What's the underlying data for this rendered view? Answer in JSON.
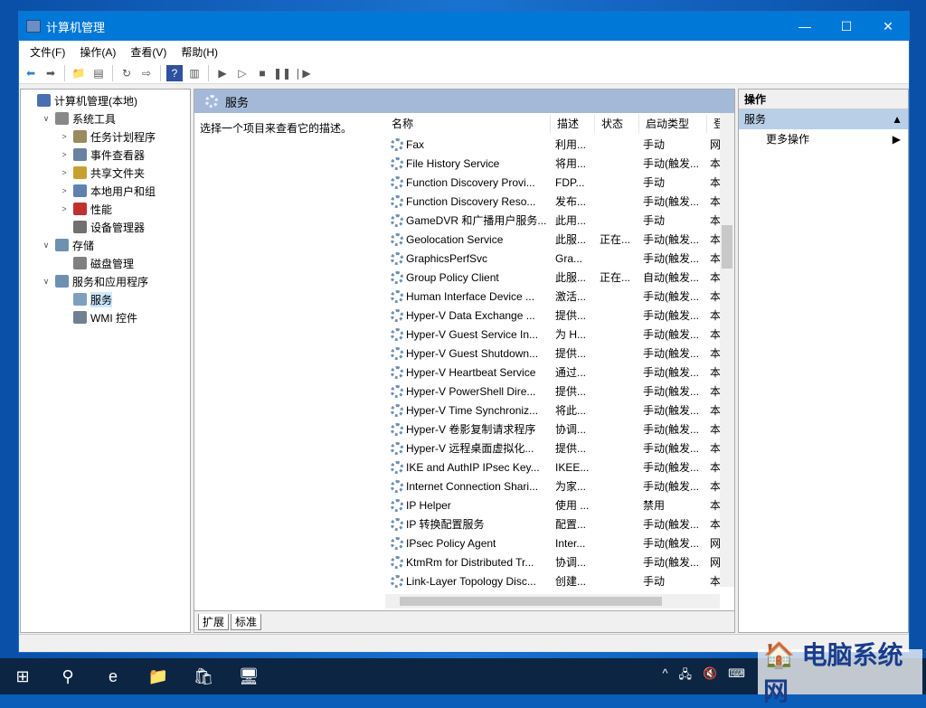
{
  "window": {
    "title": "计算机管理",
    "min": "—",
    "max": "☐",
    "close": "✕"
  },
  "menu": [
    "文件(F)",
    "操作(A)",
    "查看(V)",
    "帮助(H)"
  ],
  "toolbar": [
    "back-icon",
    "forward-icon",
    "up-folder-icon",
    "show-hide-tree-icon",
    "refresh-icon",
    "export-icon",
    "help-icon",
    "show-action-pane-icon",
    "start-icon",
    "start-alt-icon",
    "stop-icon",
    "pause-icon",
    "restart-icon"
  ],
  "tree": [
    {
      "label": "计算机管理(本地)",
      "level": 0,
      "exp": "",
      "color": "#4a6fb0"
    },
    {
      "label": "系统工具",
      "level": 1,
      "exp": "∨",
      "color": "#888"
    },
    {
      "label": "任务计划程序",
      "level": 2,
      "exp": ">",
      "color": "#9a8a60"
    },
    {
      "label": "事件查看器",
      "level": 2,
      "exp": ">",
      "color": "#6a80a0"
    },
    {
      "label": "共享文件夹",
      "level": 2,
      "exp": ">",
      "color": "#c8a030"
    },
    {
      "label": "本地用户和组",
      "level": 2,
      "exp": ">",
      "color": "#6080b0"
    },
    {
      "label": "性能",
      "level": 2,
      "exp": ">",
      "color": "#c03030"
    },
    {
      "label": "设备管理器",
      "level": 2,
      "exp": "",
      "color": "#707070"
    },
    {
      "label": "存储",
      "level": 1,
      "exp": "∨",
      "color": "#7090b0"
    },
    {
      "label": "磁盘管理",
      "level": 2,
      "exp": "",
      "color": "#808080"
    },
    {
      "label": "服务和应用程序",
      "level": 1,
      "exp": "∨",
      "color": "#7090b0"
    },
    {
      "label": "服务",
      "level": 2,
      "exp": "",
      "color": "#7f9fc0",
      "selected": true
    },
    {
      "label": "WMI 控件",
      "level": 2,
      "exp": "",
      "color": "#708090"
    }
  ],
  "main": {
    "header": "服务",
    "description": "选择一个项目来查看它的描述。",
    "columns": [
      "名称",
      "描述",
      "状态",
      "启动类型",
      "登"
    ],
    "rows": [
      [
        "Fax",
        "利用...",
        "",
        "手动",
        "网"
      ],
      [
        "File History Service",
        "将用...",
        "",
        "手动(触发...",
        "本"
      ],
      [
        "Function Discovery Provi...",
        "FDP...",
        "",
        "手动",
        "本"
      ],
      [
        "Function Discovery Reso...",
        "发布...",
        "",
        "手动(触发...",
        "本"
      ],
      [
        "GameDVR 和广播用户服务...",
        "此用...",
        "",
        "手动",
        "本"
      ],
      [
        "Geolocation Service",
        "此服...",
        "正在...",
        "手动(触发...",
        "本"
      ],
      [
        "GraphicsPerfSvc",
        "Gra...",
        "",
        "手动(触发...",
        "本"
      ],
      [
        "Group Policy Client",
        "此服...",
        "正在...",
        "自动(触发...",
        "本"
      ],
      [
        "Human Interface Device ...",
        "激活...",
        "",
        "手动(触发...",
        "本"
      ],
      [
        "Hyper-V Data Exchange ...",
        "提供...",
        "",
        "手动(触发...",
        "本"
      ],
      [
        "Hyper-V Guest Service In...",
        "为 H...",
        "",
        "手动(触发...",
        "本"
      ],
      [
        "Hyper-V Guest Shutdown...",
        "提供...",
        "",
        "手动(触发...",
        "本"
      ],
      [
        "Hyper-V Heartbeat Service",
        "通过...",
        "",
        "手动(触发...",
        "本"
      ],
      [
        "Hyper-V PowerShell Dire...",
        "提供...",
        "",
        "手动(触发...",
        "本"
      ],
      [
        "Hyper-V Time Synchroniz...",
        "将此...",
        "",
        "手动(触发...",
        "本"
      ],
      [
        "Hyper-V 卷影复制请求程序",
        "协调...",
        "",
        "手动(触发...",
        "本"
      ],
      [
        "Hyper-V 远程桌面虚拟化...",
        "提供...",
        "",
        "手动(触发...",
        "本"
      ],
      [
        "IKE and AuthIP IPsec Key...",
        "IKEE...",
        "",
        "手动(触发...",
        "本"
      ],
      [
        "Internet Connection Shari...",
        "为家...",
        "",
        "手动(触发...",
        "本"
      ],
      [
        "IP Helper",
        "使用 ...",
        "",
        "禁用",
        "本"
      ],
      [
        "IP 转换配置服务",
        "配置...",
        "",
        "手动(触发...",
        "本"
      ],
      [
        "IPsec Policy Agent",
        "Inter...",
        "",
        "手动(触发...",
        "网"
      ],
      [
        "KtmRm for Distributed Tr...",
        "协调...",
        "",
        "手动(触发...",
        "网"
      ],
      [
        "Link-Layer Topology Disc...",
        "创建...",
        "",
        "手动",
        "本"
      ]
    ],
    "tabs": [
      "扩展",
      "标准"
    ]
  },
  "actions": {
    "header": "操作",
    "section": "服务",
    "item": "更多操作"
  },
  "taskbar": {
    "items": [
      "windows-start-icon",
      "search-icon",
      "edge-icon",
      "file-explorer-icon",
      "store-icon",
      "computer-management-icon"
    ],
    "tray": [
      "^",
      "network-icon",
      "volume-muted-icon",
      "keyboard-icon"
    ]
  },
  "watermark": "电脑系统网"
}
